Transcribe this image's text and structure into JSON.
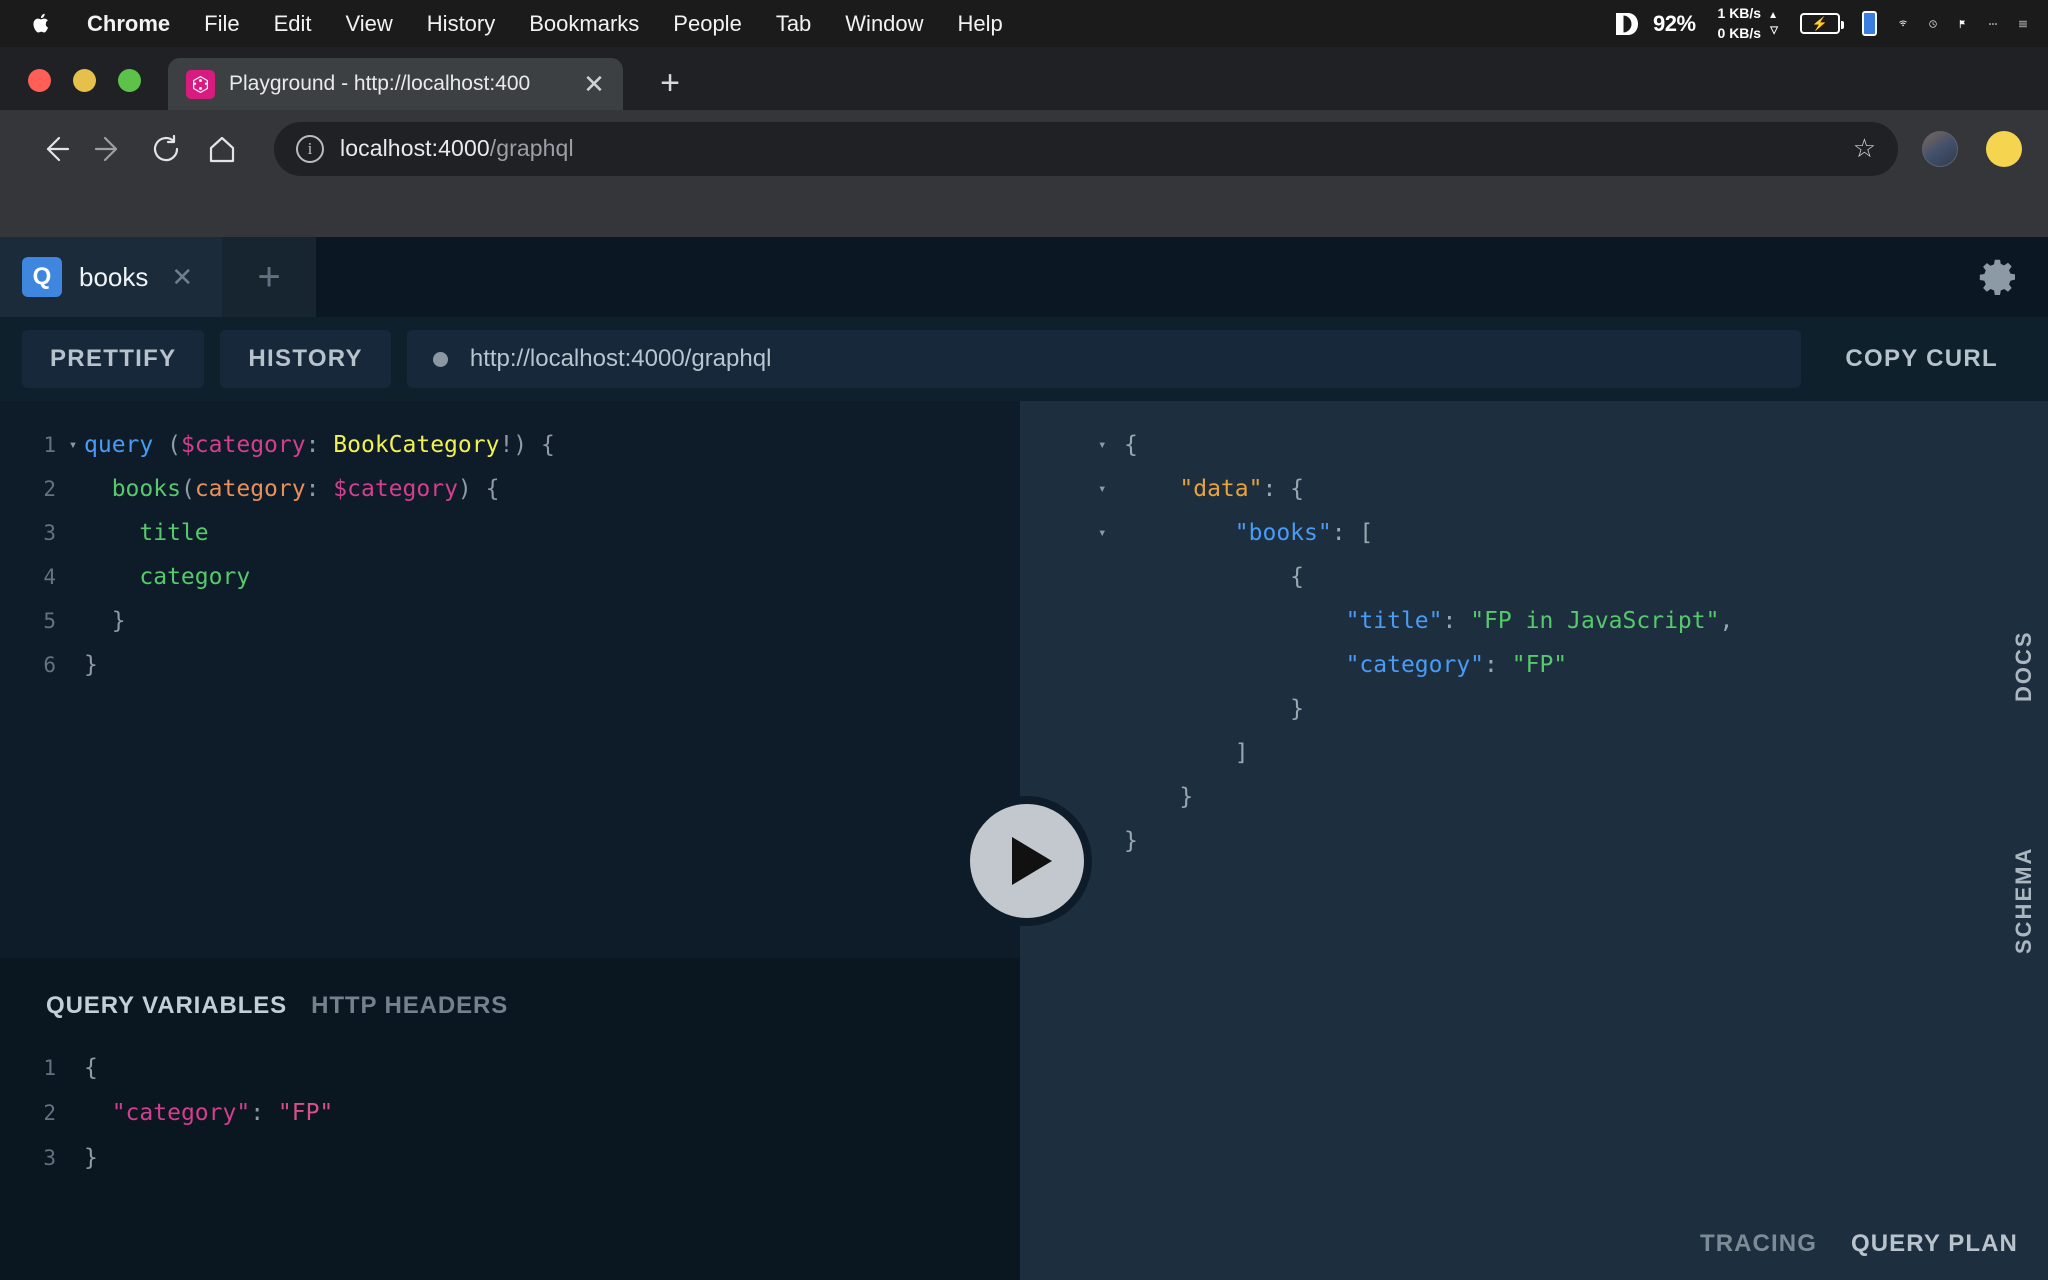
{
  "menubar": {
    "apple_icon": "apple-logo",
    "items": [
      {
        "label": "Chrome",
        "bold": true
      },
      {
        "label": "File",
        "bold": false
      },
      {
        "label": "Edit",
        "bold": false
      },
      {
        "label": "View",
        "bold": false
      },
      {
        "label": "History",
        "bold": false
      },
      {
        "label": "Bookmarks",
        "bold": false
      },
      {
        "label": "People",
        "bold": false
      },
      {
        "label": "Tab",
        "bold": false
      },
      {
        "label": "Window",
        "bold": false
      },
      {
        "label": "Help",
        "bold": false
      }
    ],
    "status": {
      "vd_percent": "92%",
      "net_down": "1 KB/s",
      "net_up": "0 KB/s",
      "net_down_arrow": "▲",
      "net_up_arrow": "▽",
      "battery_icon": "battery-charging-icon",
      "phone_icon": "phone-icon",
      "wifi_icon": "wifi-icon",
      "clock_icon": "clock-icon",
      "flag_icon": "flag-icon",
      "more_icon": "ellipsis-icon",
      "list_icon": "list-icon"
    }
  },
  "browser": {
    "traffic_lights": [
      "close",
      "minimize",
      "zoom"
    ],
    "tab": {
      "title": "Playground - http://localhost:400",
      "favicon": "graphql-icon",
      "close_icon": "close-icon"
    },
    "new_tab_icon": "plus-icon",
    "nav": {
      "back_icon": "arrow-left-icon",
      "forward_icon": "arrow-right-icon",
      "reload_icon": "reload-icon",
      "home_icon": "home-icon"
    },
    "omnibox": {
      "info_icon": "info-circle-icon",
      "url_host": "localhost:4000",
      "url_path": "/graphql",
      "star_icon": "star-icon"
    },
    "avatar": "user-avatar",
    "profile": "profile-dot"
  },
  "playground": {
    "tabs": [
      {
        "badge": "Q",
        "label": "books",
        "close_icon": "close-icon"
      }
    ],
    "add_tab_icon": "plus-icon",
    "settings_icon": "gear-icon",
    "toolbar": {
      "prettify_label": "PRETTIFY",
      "history_label": "HISTORY",
      "endpoint_url": "http://localhost:4000/graphql",
      "copy_curl_label": "COPY CURL"
    },
    "execute_button": "play-icon",
    "query_editor": {
      "lines": [
        {
          "num": "1",
          "fold": "▾",
          "tokens": [
            {
              "t": "query ",
              "c": "tok-kw"
            },
            {
              "t": "(",
              "c": "tok-punc"
            },
            {
              "t": "$category",
              "c": "tok-var"
            },
            {
              "t": ": ",
              "c": "tok-punc"
            },
            {
              "t": "BookCategory",
              "c": "tok-type"
            },
            {
              "t": "!) {",
              "c": "tok-punc"
            }
          ]
        },
        {
          "num": "2",
          "fold": "",
          "tokens": [
            {
              "t": "  ",
              "c": "tok-punc"
            },
            {
              "t": "books",
              "c": "tok-field"
            },
            {
              "t": "(",
              "c": "tok-punc"
            },
            {
              "t": "category",
              "c": "tok-arg"
            },
            {
              "t": ": ",
              "c": "tok-punc"
            },
            {
              "t": "$category",
              "c": "tok-var"
            },
            {
              "t": ") {",
              "c": "tok-punc"
            }
          ]
        },
        {
          "num": "3",
          "fold": "",
          "tokens": [
            {
              "t": "    ",
              "c": "tok-punc"
            },
            {
              "t": "title",
              "c": "tok-field"
            }
          ]
        },
        {
          "num": "4",
          "fold": "",
          "tokens": [
            {
              "t": "    ",
              "c": "tok-punc"
            },
            {
              "t": "category",
              "c": "tok-field"
            }
          ]
        },
        {
          "num": "5",
          "fold": "",
          "tokens": [
            {
              "t": "  }",
              "c": "tok-punc"
            }
          ]
        },
        {
          "num": "6",
          "fold": "",
          "tokens": [
            {
              "t": "}",
              "c": "tok-punc"
            }
          ]
        }
      ]
    },
    "variables_panel": {
      "tab_query_variables": "QUERY VARIABLES",
      "tab_http_headers": "HTTP HEADERS",
      "lines": [
        {
          "num": "1",
          "tokens": [
            {
              "t": "{",
              "c": "tok-punc"
            }
          ]
        },
        {
          "num": "2",
          "tokens": [
            {
              "t": "  ",
              "c": "tok-punc"
            },
            {
              "t": "\"category\"",
              "c": "tok-key"
            },
            {
              "t": ": ",
              "c": "tok-punc"
            },
            {
              "t": "\"FP\"",
              "c": "tok-str"
            }
          ]
        },
        {
          "num": "3",
          "tokens": [
            {
              "t": "}",
              "c": "tok-punc"
            }
          ]
        }
      ]
    },
    "response": {
      "lines": [
        {
          "fold": "▾",
          "indent": 0,
          "tokens": [
            {
              "t": "{",
              "c": "json-punc"
            }
          ]
        },
        {
          "fold": "▾",
          "indent": 1,
          "tokens": [
            {
              "t": "\"data\"",
              "c": "json-key-orange"
            },
            {
              "t": ": {",
              "c": "json-punc"
            }
          ]
        },
        {
          "fold": "▾",
          "indent": 2,
          "tokens": [
            {
              "t": "\"books\"",
              "c": "json-key"
            },
            {
              "t": ": [",
              "c": "json-punc"
            }
          ]
        },
        {
          "fold": "",
          "indent": 3,
          "tokens": [
            {
              "t": "{",
              "c": "json-punc"
            }
          ]
        },
        {
          "fold": "",
          "indent": 4,
          "tokens": [
            {
              "t": "\"title\"",
              "c": "json-key"
            },
            {
              "t": ": ",
              "c": "json-punc"
            },
            {
              "t": "\"FP in JavaScript\"",
              "c": "json-str"
            },
            {
              "t": ",",
              "c": "json-punc"
            }
          ]
        },
        {
          "fold": "",
          "indent": 4,
          "tokens": [
            {
              "t": "\"category\"",
              "c": "json-key"
            },
            {
              "t": ": ",
              "c": "json-punc"
            },
            {
              "t": "\"FP\"",
              "c": "json-str"
            }
          ]
        },
        {
          "fold": "",
          "indent": 3,
          "tokens": [
            {
              "t": "}",
              "c": "json-punc"
            }
          ]
        },
        {
          "fold": "",
          "indent": 2,
          "tokens": [
            {
              "t": "]",
              "c": "json-punc"
            }
          ]
        },
        {
          "fold": "",
          "indent": 1,
          "tokens": [
            {
              "t": "}",
              "c": "json-punc"
            }
          ]
        },
        {
          "fold": "",
          "indent": 0,
          "tokens": [
            {
              "t": "}",
              "c": "json-punc"
            }
          ]
        }
      ]
    },
    "side_tabs": {
      "docs_label": "DOCS",
      "schema_label": "SCHEMA"
    },
    "footer": {
      "tracing_label": "TRACING",
      "query_plan_label": "QUERY PLAN"
    }
  }
}
